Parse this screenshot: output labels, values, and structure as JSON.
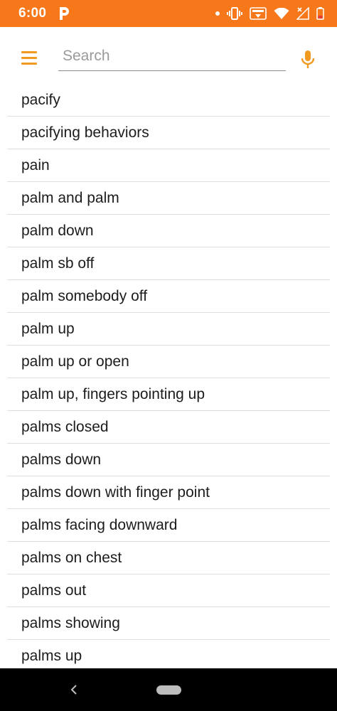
{
  "status_bar": {
    "time": "6:00",
    "bg_color": "#f7771b",
    "icons": [
      "parking-icon",
      "notification-dot-icon",
      "vibrate-icon",
      "volte-icon",
      "wifi-icon",
      "signal-icon",
      "battery-low-icon"
    ]
  },
  "header": {
    "search_placeholder": "Search",
    "search_value": "",
    "accent_color": "#f19a1f"
  },
  "list": {
    "items": [
      "pacify",
      "pacifying behaviors",
      "pain",
      "palm and palm",
      "palm down",
      "palm sb off",
      "palm somebody off",
      "palm up",
      "palm up or open",
      "palm up, fingers pointing up",
      "palms closed",
      "palms down",
      "palms down with finger point",
      "palms facing downward",
      "palms on chest",
      "palms out",
      "palms showing",
      "palms up"
    ]
  },
  "nav_bar": {
    "icons": [
      "back-icon",
      "home-pill-icon"
    ]
  }
}
